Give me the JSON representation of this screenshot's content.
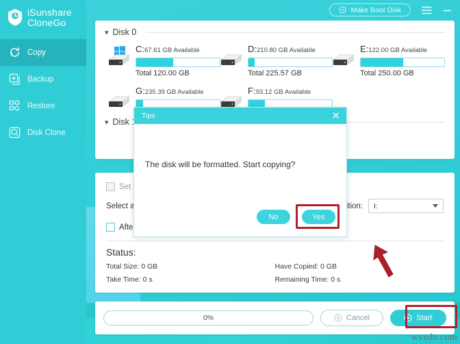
{
  "app": {
    "brand_line1": "iSunshare",
    "brand_line2": "CloneGo"
  },
  "sidebar": {
    "items": [
      {
        "label": "Copy",
        "icon": "copy-refresh-icon",
        "active": true
      },
      {
        "label": "Backup",
        "icon": "backup-plus-icon",
        "active": false
      },
      {
        "label": "Restore",
        "icon": "restore-grid-icon",
        "active": false
      },
      {
        "label": "Disk Clone",
        "icon": "disk-clone-icon",
        "active": false
      }
    ]
  },
  "topbar": {
    "make_boot_disk": "Make Boot Disk",
    "menu_icon": "hamburger-menu-icon",
    "minimize_icon": "minimize-icon",
    "boot_icon": "disc-icon"
  },
  "disks": {
    "group0_label": "Disk 0",
    "group1_label": "Disk 1",
    "drives": [
      {
        "letter": "C:",
        "available": "67.61 GB Available",
        "total": "Total 120.00 GB",
        "fill_pct": 44,
        "system": true
      },
      {
        "letter": "D:",
        "available": "210.80 GB Available",
        "total": "Total 225.57 GB",
        "fill_pct": 7,
        "system": false
      },
      {
        "letter": "E:",
        "available": "122.00 GB Available",
        "total": "Total 250.00 GB",
        "fill_pct": 51,
        "system": false
      },
      {
        "letter": "G:",
        "available": "235.39 GB Available",
        "total": "",
        "fill_pct": 0,
        "system": false
      },
      {
        "letter": "F:",
        "available": "93.12 GB Available",
        "total": "",
        "fill_pct": 0,
        "system": false
      }
    ]
  },
  "options": {
    "set_target_label": "Set t",
    "select_label": "Select a",
    "after_label": "After",
    "partition_label": "artition:",
    "partition_value": "I:"
  },
  "status": {
    "title": "Status:",
    "total_size": "Total Size: 0 GB",
    "have_copied": "Have Copied: 0 GB",
    "take_time": "Take Time: 0 s",
    "remaining_time": "Remaining Time: 0 s"
  },
  "footer": {
    "progress_text": "0%",
    "progress_pct": 0,
    "cancel_label": "Cancel",
    "start_label": "Start",
    "cancel_icon": "cancel-circle-icon",
    "start_icon": "play-circle-icon"
  },
  "modal": {
    "title": "Tips",
    "close_icon": "close-icon",
    "message": "The disk will be formatted. Start copying?",
    "no_label": "No",
    "yes_label": "Yes"
  },
  "annotations": {
    "watermark": "wsxdn.com",
    "highlight_color": "#b01f2a",
    "arrow_color": "#b01f2a"
  },
  "colors": {
    "brand_teal": "#31cdd6",
    "accent_teal": "#3fd3dd",
    "sidebar_active": "#25b4bd",
    "panel_bg": "#ffffff"
  }
}
